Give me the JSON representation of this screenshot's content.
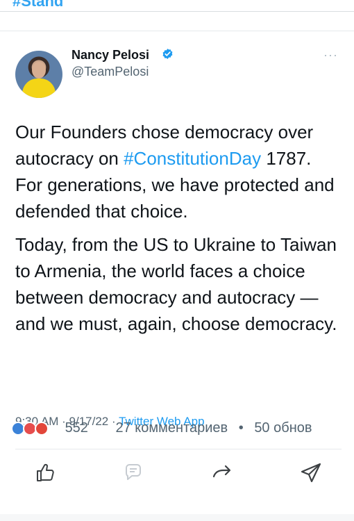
{
  "top": {
    "hashtag_cut": "#Stand"
  },
  "tweet": {
    "author_name": "Nancy Pelosi",
    "handle": "@TeamPelosi",
    "more": "···",
    "paragraph1_a": "Our Founders chose democracy over autocracy on ",
    "paragraph1_hashtag": "#ConstitutionDay",
    "paragraph1_b": " 1787. For generations, we have protected and defended that choice.",
    "paragraph2": "Today, from the US to Ukraine to Taiwan to Armenia, the world faces a choice between democracy and autocracy — and we must, again, choose democracy.",
    "time": "9:30 AM",
    "date": "9/17/22",
    "sep": "·",
    "app": "Twitter Web App"
  },
  "reactions": {
    "count": "552",
    "comments": "27 комментариев",
    "dot": "•",
    "shares": "50 обнов"
  },
  "colors": {
    "accent": "#1d9bf0",
    "muted": "#536471"
  },
  "icons": [
    "verified-badge-icon",
    "thumbs-up-icon",
    "comment-icon",
    "share-arrow-icon",
    "send-icon"
  ]
}
